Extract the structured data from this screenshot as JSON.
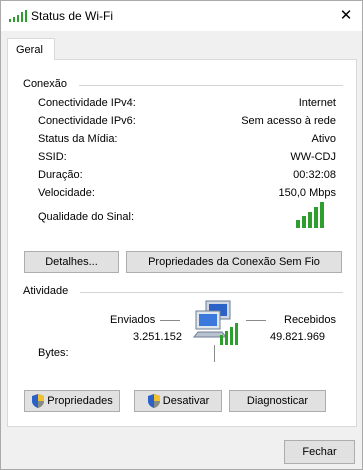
{
  "window": {
    "title": "Status de Wi-Fi",
    "close_glyph": "✕"
  },
  "tabs": [
    {
      "label": "Geral"
    }
  ],
  "connection": {
    "heading": "Conexão",
    "rows": [
      {
        "label": "Conectividade IPv4:",
        "value": "Internet"
      },
      {
        "label": "Conectividade IPv6:",
        "value": "Sem acesso à rede"
      },
      {
        "label": "Status da Mídia:",
        "value": "Ativo"
      },
      {
        "label": "SSID:",
        "value": "WW-CDJ"
      },
      {
        "label": "Duração:",
        "value": "00:32:08"
      },
      {
        "label": "Velocidade:",
        "value": "150,0 Mbps"
      }
    ],
    "signal_label": "Qualidade do Sinal:",
    "signal_bars": 5,
    "signal_color": "#2e9e2e"
  },
  "buttons_top": {
    "details": "Detalhes...",
    "wireless_props": "Propriedades da Conexão Sem Fio"
  },
  "activity": {
    "heading": "Atividade",
    "sent_label": "Enviados",
    "received_label": "Recebidos",
    "bytes_label": "Bytes:",
    "sent_value": "3.251.152",
    "received_value": "49.821.969",
    "icon": "network-computers-icon"
  },
  "buttons_bottom": {
    "properties": "Propriedades",
    "disable": "Desativar",
    "diagnose": "Diagnosticar"
  },
  "footer": {
    "close": "Fechar"
  },
  "colors": {
    "accent_green": "#2e9e2e",
    "button_bg": "#e1e1e1",
    "shield_blue": "#2b62c8",
    "shield_yellow": "#f2c12e"
  }
}
